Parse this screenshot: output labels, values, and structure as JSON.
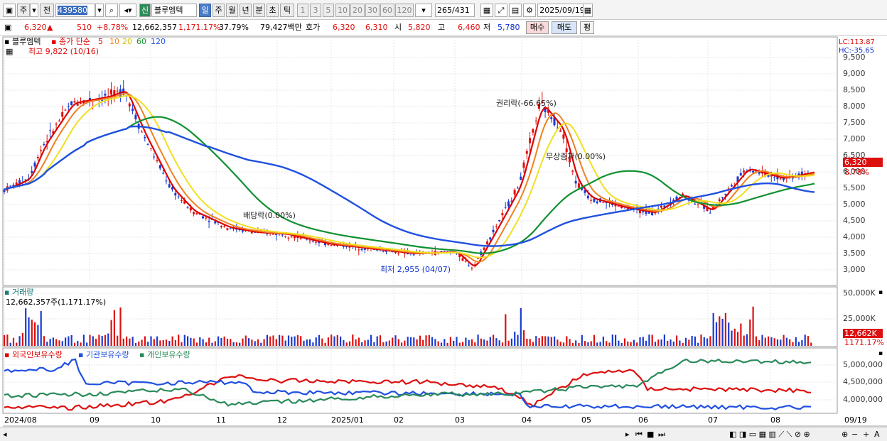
{
  "toolbar": {
    "period_label": "주",
    "prev_label": "전",
    "code": "439580",
    "new_badge": "신",
    "stock_name": "블루엠텍",
    "periods": [
      "일",
      "주",
      "월",
      "년",
      "분",
      "초",
      "틱"
    ],
    "nums": [
      "1",
      "3",
      "5",
      "10",
      "20",
      "30",
      "60",
      "120"
    ],
    "count": "265",
    "total": "/431",
    "date": "2025/09/19"
  },
  "quote": {
    "price": "6,320",
    "change": "510",
    "change_pct": "+8.78%",
    "volume": "12,662,357",
    "volume_ratio": "1,171.17%",
    "turnover": "37.79%",
    "amount": "79,427백만",
    "hoga_label": "호가",
    "ask": "6,320",
    "bid": "6,310",
    "open_label": "시",
    "open": "5,820",
    "high_label": "고",
    "high": "6,460",
    "low_label": "저",
    "low": "5,780",
    "buy_label": "매수",
    "sell_label": "매도",
    "eval_label": "평"
  },
  "chart": {
    "stock_label": "블루엠텍",
    "ma_title": "종가 단순",
    "ma_periods": [
      "5",
      "10",
      "20",
      "60",
      "120"
    ],
    "ma_colors": [
      "#dd0000",
      "#f08020",
      "#f0e020",
      "#109030",
      "#2050e0"
    ],
    "high_marker": "최고 9,822 (10/16)",
    "low_marker": "최저 2,955 (04/07)",
    "annotation_rights": "권리락(-66.65%)",
    "annotation_dividend": "배당락(0.00%)",
    "annotation_bonus": "무상증자(0.00%)",
    "lc": "LC:113.87",
    "hc": "HC:-35.65",
    "price_axis": [
      "9,500",
      "9,000",
      "8,500",
      "8,000",
      "7,500",
      "7,000",
      "6,500",
      "6,000",
      "5,500",
      "5,000",
      "4,500",
      "4,000",
      "3,500",
      "3,000"
    ],
    "current_tag": "6,320",
    "current_pct": "8.78%",
    "volume_title": "거래량",
    "volume_value": "12,662,357주(1,171.17%)",
    "volume_axis": [
      "50,000K",
      "25,000K"
    ],
    "volume_tag": "12,662K",
    "volume_pct": "1171.17%",
    "holders_labels": [
      "외국인보유수량",
      "기관보유수량",
      "개인보유수량"
    ],
    "holders_axis": [
      "5,000,000",
      "4,500,000",
      "4,000,000"
    ],
    "x_axis": [
      "2024/08",
      "09",
      "10",
      "11",
      "12",
      "2025/01",
      "02",
      "03",
      "04",
      "05",
      "06",
      "07",
      "08",
      "09"
    ],
    "x_end": "09/19"
  }
}
